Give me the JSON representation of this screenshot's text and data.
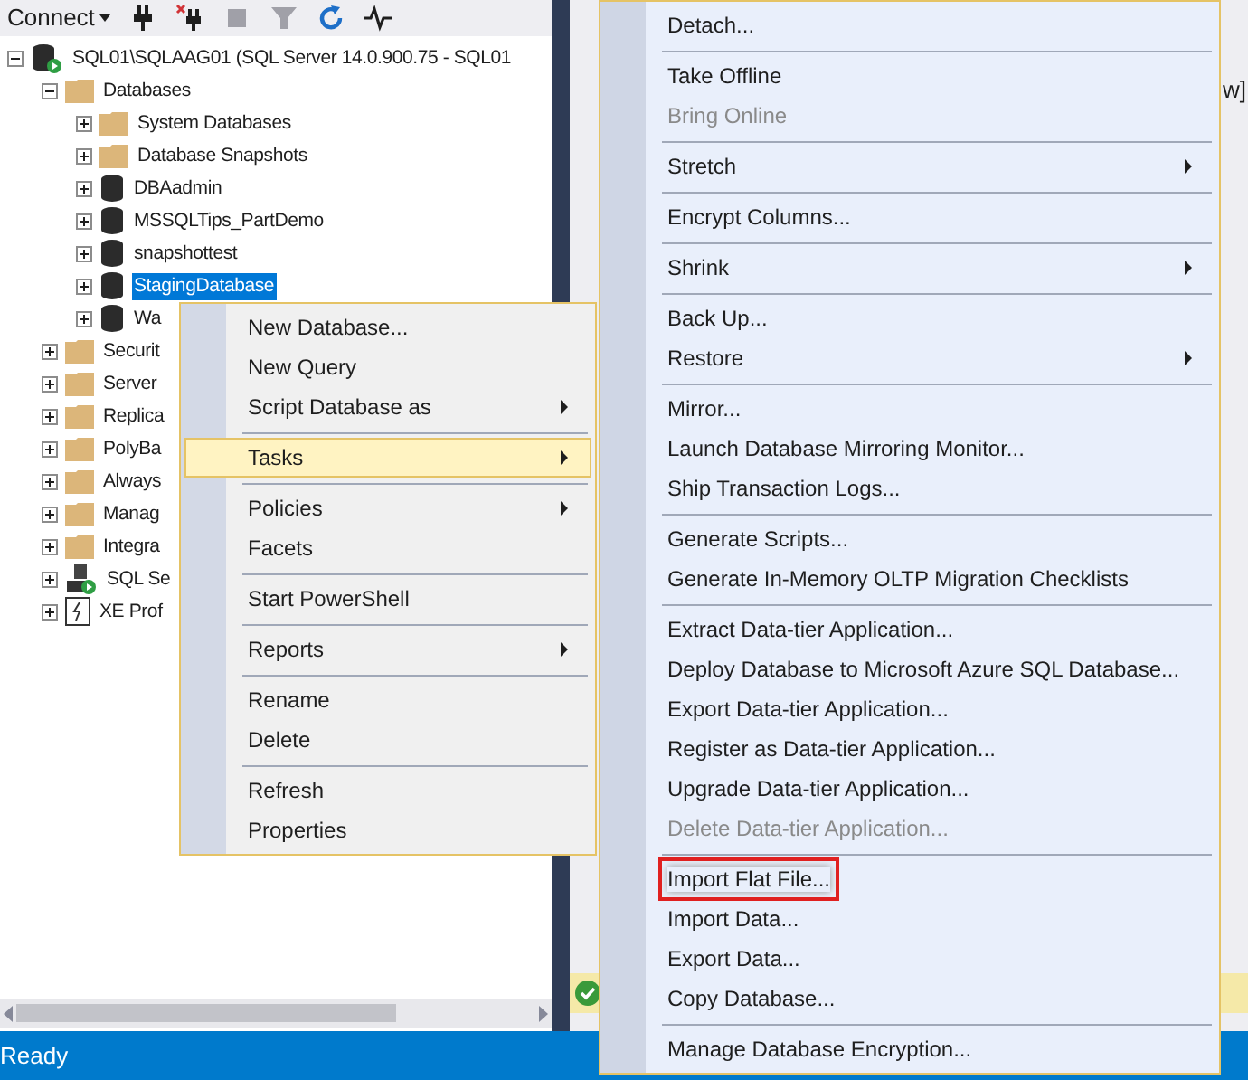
{
  "toolbar": {
    "connect": "Connect",
    "buttons": [
      {
        "kind": "plug",
        "disabled": false
      },
      {
        "kind": "unplug",
        "disabled": false
      },
      {
        "kind": "stop",
        "disabled": true
      },
      {
        "kind": "filter",
        "disabled": true
      },
      {
        "kind": "refresh",
        "disabled": false
      },
      {
        "kind": "activity",
        "disabled": false
      }
    ]
  },
  "tree": [
    {
      "label": "SQL01\\SQLAAG01 (SQL Server 14.0.900.75 - SQL01",
      "kind": "server",
      "expanded": true,
      "selected": false,
      "children": [
        {
          "label": "Databases",
          "kind": "folder",
          "expanded": true,
          "selected": false,
          "children": [
            {
              "label": "System Databases",
              "kind": "folder",
              "expanded": false,
              "selected": false
            },
            {
              "label": "Database Snapshots",
              "kind": "folder",
              "expanded": false,
              "selected": false
            },
            {
              "label": "DBAadmin",
              "kind": "database",
              "expanded": false,
              "selected": false
            },
            {
              "label": "MSSQLTips_PartDemo",
              "kind": "database",
              "expanded": false,
              "selected": false
            },
            {
              "label": "snapshottest",
              "kind": "database",
              "expanded": false,
              "selected": false
            },
            {
              "label": "StagingDatabase",
              "kind": "database",
              "expanded": false,
              "selected": true
            },
            {
              "label": "Wa",
              "kind": "database",
              "expanded": false,
              "selected": false
            }
          ]
        },
        {
          "label": "Securit",
          "kind": "folder",
          "expanded": false,
          "selected": false
        },
        {
          "label": "Server",
          "kind": "folder",
          "expanded": false,
          "selected": false
        },
        {
          "label": "Replica",
          "kind": "folder",
          "expanded": false,
          "selected": false
        },
        {
          "label": "PolyBa",
          "kind": "folder",
          "expanded": false,
          "selected": false
        },
        {
          "label": "Always",
          "kind": "folder",
          "expanded": false,
          "selected": false
        },
        {
          "label": "Manag",
          "kind": "folder",
          "expanded": false,
          "selected": false
        },
        {
          "label": "Integra",
          "kind": "folder",
          "expanded": false,
          "selected": false
        },
        {
          "label": "SQL Se",
          "kind": "agent",
          "expanded": false,
          "selected": false
        },
        {
          "label": "XE Prof",
          "kind": "xe",
          "expanded": false,
          "selected": false
        }
      ]
    }
  ],
  "right_pane": {
    "fragment": "w]"
  },
  "context_menu": [
    {
      "kind": "item",
      "label": "New Database...",
      "submenu": false,
      "selected": false
    },
    {
      "kind": "item",
      "label": "New Query",
      "submenu": false,
      "selected": false
    },
    {
      "kind": "item",
      "label": "Script Database as",
      "submenu": true,
      "selected": false
    },
    {
      "kind": "separator"
    },
    {
      "kind": "item",
      "label": "Tasks",
      "submenu": true,
      "selected": true
    },
    {
      "kind": "separator"
    },
    {
      "kind": "item",
      "label": "Policies",
      "submenu": true,
      "selected": false
    },
    {
      "kind": "item",
      "label": "Facets",
      "submenu": false,
      "selected": false
    },
    {
      "kind": "separator"
    },
    {
      "kind": "item",
      "label": "Start PowerShell",
      "submenu": false,
      "selected": false
    },
    {
      "kind": "separator"
    },
    {
      "kind": "item",
      "label": "Reports",
      "submenu": true,
      "selected": false
    },
    {
      "kind": "separator"
    },
    {
      "kind": "item",
      "label": "Rename",
      "submenu": false,
      "selected": false
    },
    {
      "kind": "item",
      "label": "Delete",
      "submenu": false,
      "selected": false
    },
    {
      "kind": "separator"
    },
    {
      "kind": "item",
      "label": "Refresh",
      "submenu": false,
      "selected": false
    },
    {
      "kind": "item",
      "label": "Properties",
      "submenu": false,
      "selected": false
    }
  ],
  "tasks_menu": [
    {
      "kind": "item",
      "label": "Detach...",
      "submenu": false,
      "disabled": false,
      "marked": false
    },
    {
      "kind": "separator"
    },
    {
      "kind": "item",
      "label": "Take Offline",
      "submenu": false,
      "disabled": false,
      "marked": false
    },
    {
      "kind": "item",
      "label": "Bring Online",
      "submenu": false,
      "disabled": true,
      "marked": false
    },
    {
      "kind": "separator"
    },
    {
      "kind": "item",
      "label": "Stretch",
      "submenu": true,
      "disabled": false,
      "marked": false
    },
    {
      "kind": "separator"
    },
    {
      "kind": "item",
      "label": "Encrypt Columns...",
      "submenu": false,
      "disabled": false,
      "marked": false
    },
    {
      "kind": "separator"
    },
    {
      "kind": "item",
      "label": "Shrink",
      "submenu": true,
      "disabled": false,
      "marked": false
    },
    {
      "kind": "separator"
    },
    {
      "kind": "item",
      "label": "Back Up...",
      "submenu": false,
      "disabled": false,
      "marked": false
    },
    {
      "kind": "item",
      "label": "Restore",
      "submenu": true,
      "disabled": false,
      "marked": false
    },
    {
      "kind": "separator"
    },
    {
      "kind": "item",
      "label": "Mirror...",
      "submenu": false,
      "disabled": false,
      "marked": false
    },
    {
      "kind": "item",
      "label": "Launch Database Mirroring Monitor...",
      "submenu": false,
      "disabled": false,
      "marked": false
    },
    {
      "kind": "item",
      "label": "Ship Transaction Logs...",
      "submenu": false,
      "disabled": false,
      "marked": false
    },
    {
      "kind": "separator"
    },
    {
      "kind": "item",
      "label": "Generate Scripts...",
      "submenu": false,
      "disabled": false,
      "marked": false
    },
    {
      "kind": "item",
      "label": "Generate In-Memory OLTP Migration Checklists",
      "submenu": false,
      "disabled": false,
      "marked": false
    },
    {
      "kind": "separator"
    },
    {
      "kind": "item",
      "label": "Extract Data-tier Application...",
      "submenu": false,
      "disabled": false,
      "marked": false
    },
    {
      "kind": "item",
      "label": "Deploy Database to Microsoft Azure SQL Database...",
      "submenu": false,
      "disabled": false,
      "marked": false
    },
    {
      "kind": "item",
      "label": "Export Data-tier Application...",
      "submenu": false,
      "disabled": false,
      "marked": false
    },
    {
      "kind": "item",
      "label": "Register as Data-tier Application...",
      "submenu": false,
      "disabled": false,
      "marked": false
    },
    {
      "kind": "item",
      "label": "Upgrade Data-tier Application...",
      "submenu": false,
      "disabled": false,
      "marked": false
    },
    {
      "kind": "item",
      "label": "Delete Data-tier Application...",
      "submenu": false,
      "disabled": true,
      "marked": false
    },
    {
      "kind": "separator"
    },
    {
      "kind": "item",
      "label": "Import Flat File...",
      "submenu": false,
      "disabled": false,
      "marked": true
    },
    {
      "kind": "item",
      "label": "Import Data...",
      "submenu": false,
      "disabled": false,
      "marked": false
    },
    {
      "kind": "item",
      "label": "Export Data...",
      "submenu": false,
      "disabled": false,
      "marked": false
    },
    {
      "kind": "item",
      "label": "Copy Database...",
      "submenu": false,
      "disabled": false,
      "marked": false
    },
    {
      "kind": "separator"
    },
    {
      "kind": "item",
      "label": "Manage Database Encryption...",
      "submenu": false,
      "disabled": false,
      "marked": false
    }
  ],
  "status_bar": {
    "text": "Ready"
  }
}
